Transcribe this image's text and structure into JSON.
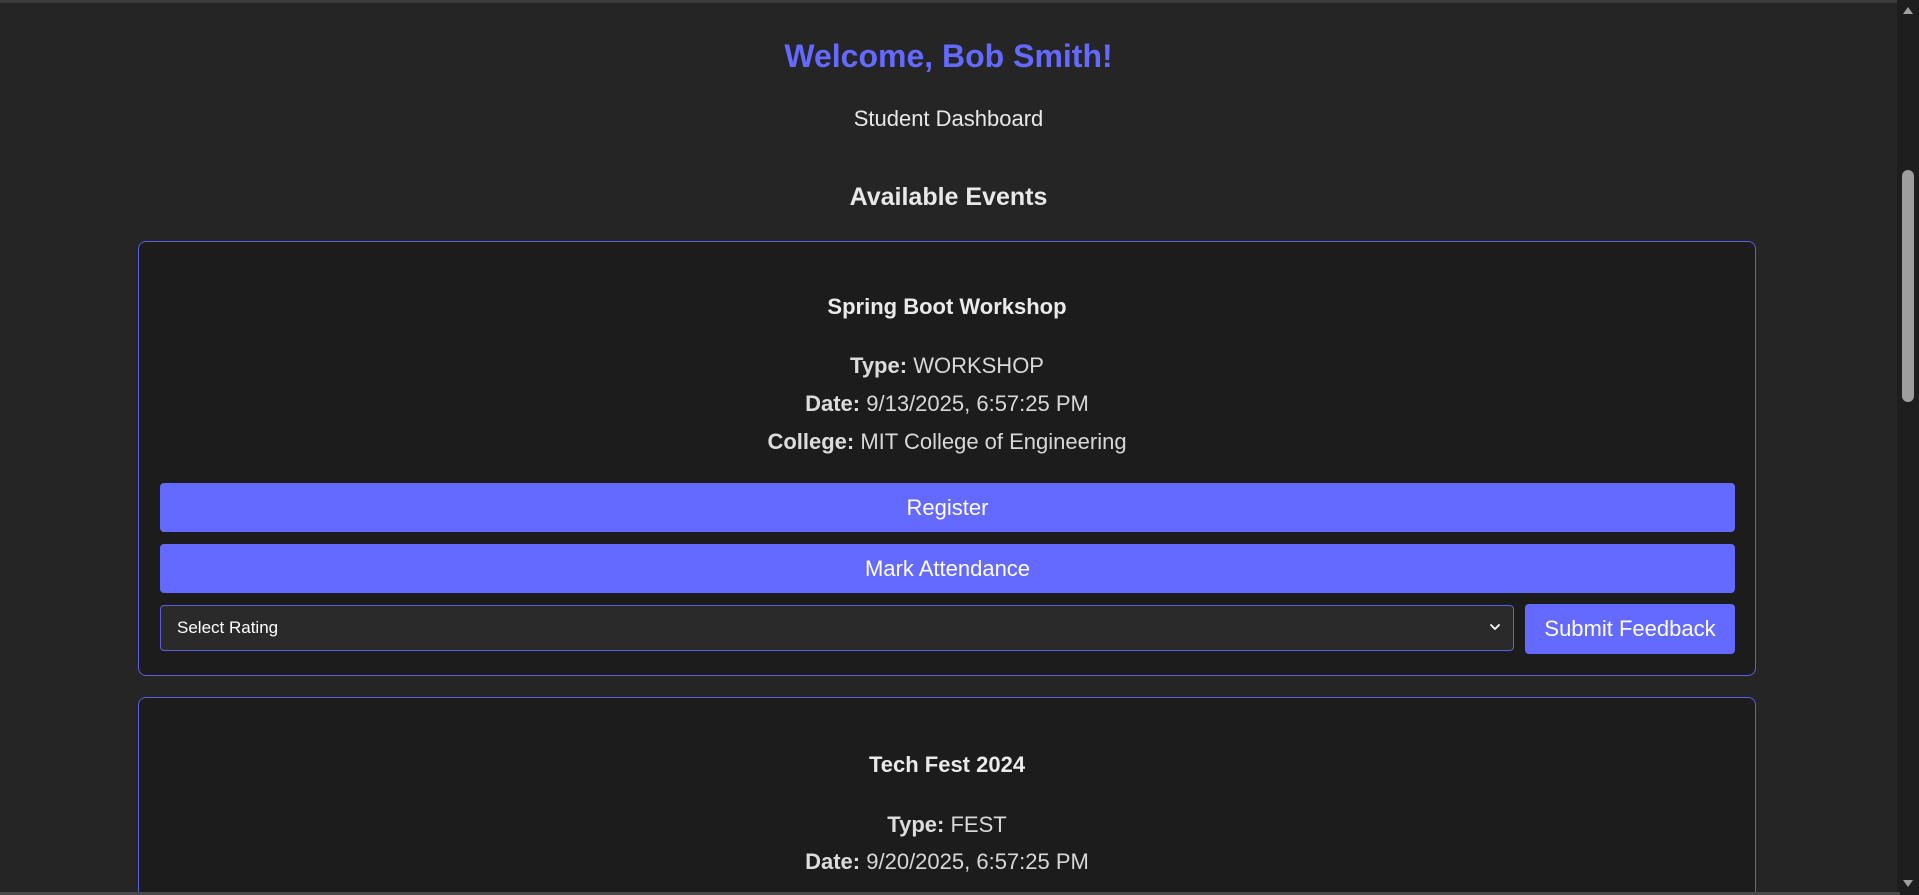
{
  "header": {
    "welcome": "Welcome, Bob Smith!",
    "subtitle": "Student Dashboard"
  },
  "events_section": {
    "title": "Available Events"
  },
  "labels": {
    "type": "Type:",
    "date": "Date:",
    "college": "College:"
  },
  "events": [
    {
      "name": "Spring Boot Workshop",
      "type": "WORKSHOP",
      "date": "9/13/2025, 6:57:25 PM",
      "college": "MIT College of Engineering",
      "register_label": "Register",
      "attendance_label": "Mark Attendance",
      "rating_selected": "Select Rating",
      "submit_label": "Submit Feedback"
    },
    {
      "name": "Tech Fest 2024",
      "type": "FEST",
      "date": "9/20/2025, 6:57:25 PM"
    }
  ],
  "colors": {
    "accent": "#6469ff",
    "background": "#252525",
    "card": "#1c1c1c"
  },
  "icons": {
    "select_arrow": "chevron-down-icon",
    "scroll_up": "scroll-up-arrow-icon",
    "scroll_down": "scroll-down-arrow-icon"
  }
}
